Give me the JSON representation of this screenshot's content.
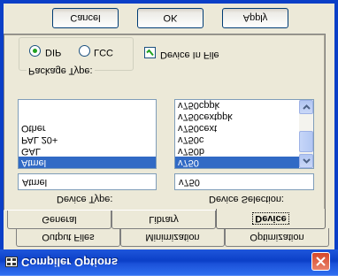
{
  "window": {
    "title": "Compiler Options",
    "icon": "app-icon",
    "close_icon": "close-icon"
  },
  "tabs_back": [
    {
      "label": "Output Files"
    },
    {
      "label": "Minimization"
    },
    {
      "label": "Optimization"
    }
  ],
  "tabs_front": [
    {
      "label": "General"
    },
    {
      "label": "Library"
    },
    {
      "label": "Device"
    }
  ],
  "device_type": {
    "label": "Device Type:",
    "value": "Atmel",
    "items": [
      "Atmel",
      "GAL",
      "PAL 20+",
      "Other"
    ],
    "selected": "Atmel"
  },
  "device_selection": {
    "label": "Device Selection:",
    "value": "v750",
    "items": [
      "v750",
      "v750b",
      "v750c",
      "v750cext",
      "v750cextppk",
      "v750cppk"
    ],
    "selected": "v750"
  },
  "package_type": {
    "label": "Package Type:",
    "options": [
      {
        "label": "DIP",
        "checked": true
      },
      {
        "label": "LCC",
        "checked": false
      }
    ]
  },
  "device_in_file": {
    "label": "Device In File",
    "checked": true
  },
  "buttons": {
    "cancel": "Cancel",
    "ok": "OK",
    "apply": "Apply"
  },
  "colors": {
    "titlebar": "#0b3fc7",
    "selection": "#316ac5",
    "close": "#d6472a"
  }
}
